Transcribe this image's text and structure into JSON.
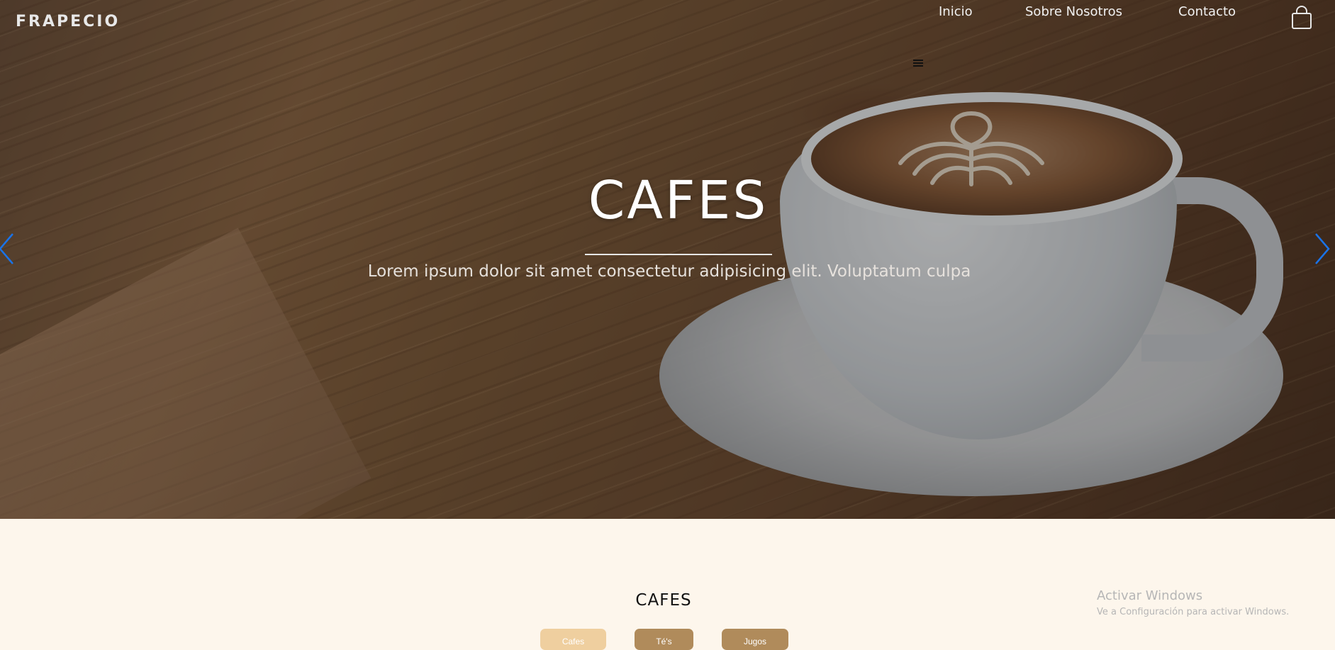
{
  "header": {
    "brand": "FRAPECIO",
    "nav": [
      {
        "label": "Inicio"
      },
      {
        "label": "Sobre Nosotros"
      },
      {
        "label": "Contacto"
      }
    ],
    "cart_icon": "shopping-bag-icon",
    "menu_icon": "hamburger-icon"
  },
  "hero": {
    "title": "CAFES",
    "subtitle": "Lorem ipsum dolor sit amet consectetur adipisicing elit. Voluptatum culpa",
    "prev_icon": "chevron-left-icon",
    "next_icon": "chevron-right-icon",
    "arrow_color": "#1a73e8"
  },
  "products": {
    "title": "CAFES",
    "filters": [
      {
        "label": "Cafes",
        "color": "#efcf9f",
        "active": true
      },
      {
        "label": "Té's",
        "color": "#b08b5b",
        "active": false
      },
      {
        "label": "Jugos",
        "color": "#b08b5b",
        "active": false
      }
    ]
  },
  "watermark": {
    "line1": "Activar Windows",
    "line2": "Ve a Configuración para activar Windows."
  }
}
